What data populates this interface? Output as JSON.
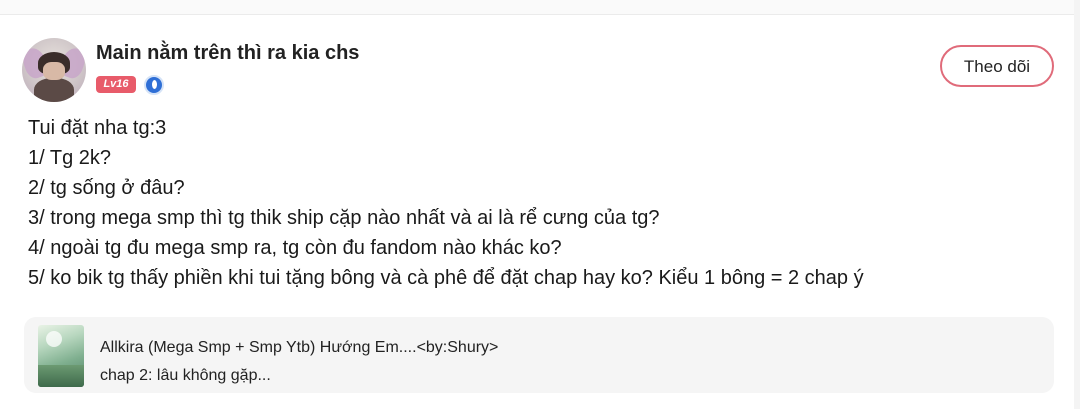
{
  "post": {
    "author": {
      "name": "Main nằm trên thì ra kia chs",
      "level": "Lv16",
      "verified_icon": "verified-badge-icon"
    },
    "follow_label": "Theo dõi",
    "lines": [
      "Tui đặt nha tg:3",
      "1/ Tg 2k?",
      "2/ tg sống ở đâu?",
      "3/ trong mega smp thì tg thik ship cặp nào nhất và ai là rể cưng của tg?",
      "4/ ngoài tg đu mega smp ra, tg còn đu fandom nào khác ko?",
      "5/ ko bik tg thấy phiền khi tui tặng bông và cà phê để đặt chap hay ko? Kiểu 1 bông = 2 chap ý"
    ],
    "story": {
      "title": "Allkira (Mega Smp + Smp Ytb) Hướng Em....<by:Shury>",
      "chapter": "chap 2: lâu không gặp..."
    }
  },
  "colors": {
    "accent": "#e06b7a",
    "level_badge": "#e85b6a",
    "verified": "#2f6fd6",
    "card_background": "#f5f5f5"
  }
}
